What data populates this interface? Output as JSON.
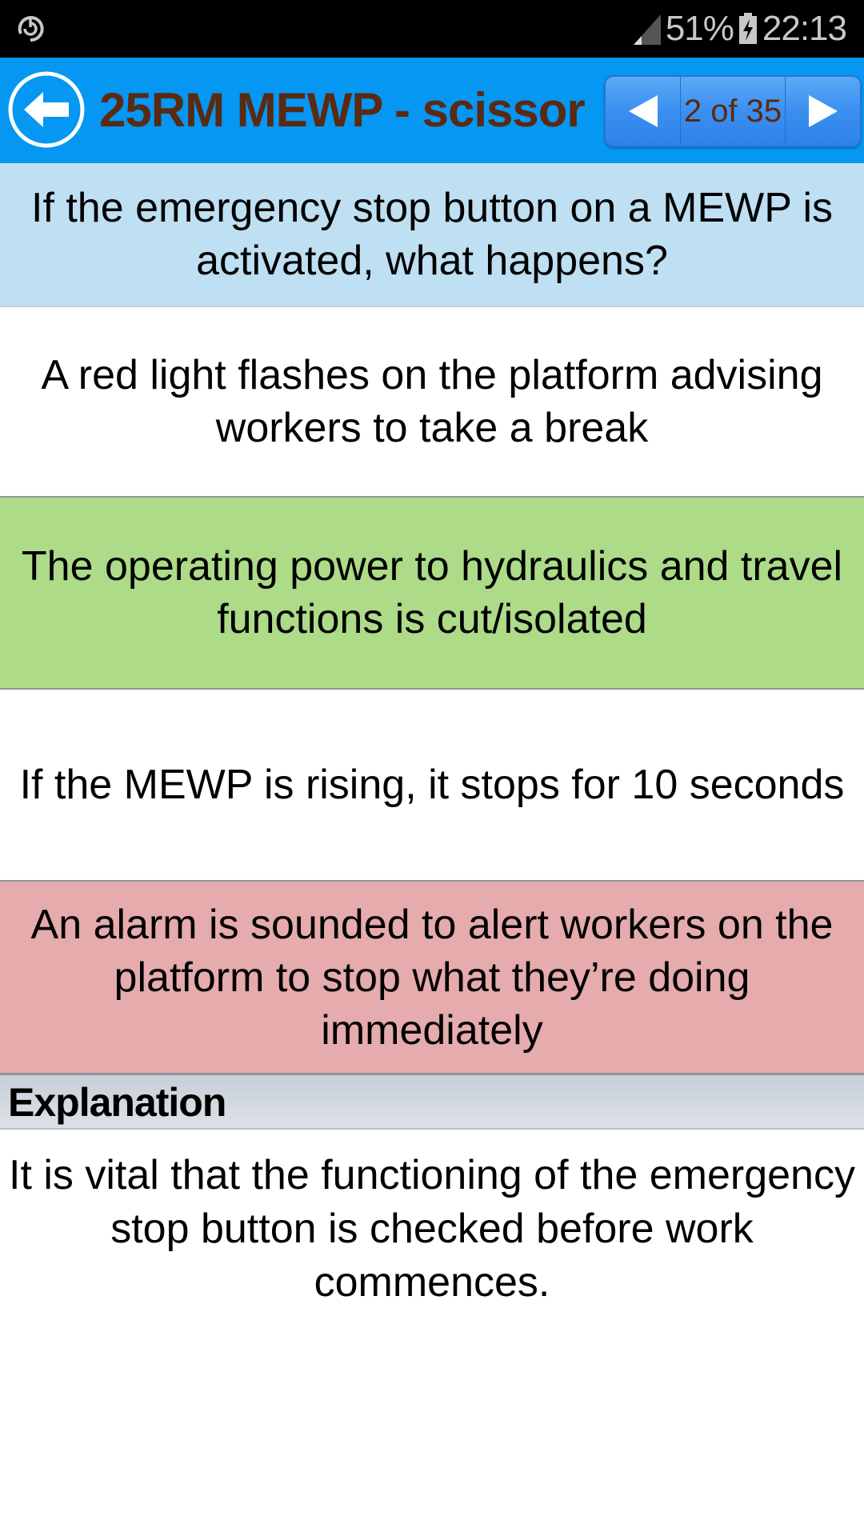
{
  "status_bar": {
    "left_icon": "sync-icon",
    "battery_percent": "51%",
    "time": "22:13",
    "icons": [
      "signal-icon",
      "battery-charging-icon"
    ]
  },
  "header": {
    "back_icon": "back-arrow-circle-icon",
    "title": "25RM MEWP - scissor",
    "pager": {
      "prev_icon": "triangle-left-icon",
      "count": "2 of 35",
      "next_icon": "triangle-right-icon"
    },
    "colors": {
      "bar": "#0597f2",
      "title": "#5a2a12"
    }
  },
  "question": {
    "text": "If the emergency stop button on a MEWP is activated, what happens?"
  },
  "answers": [
    {
      "text": "A red light flashes on the platform advising workers to take a break",
      "state": "neutral",
      "color": "#ffffff"
    },
    {
      "text": "The operating power to hydraulics and travel functions is cut/isolated",
      "state": "correct",
      "color": "#addb88"
    },
    {
      "text": "If the MEWP is rising, it stops for 10 seconds",
      "state": "neutral",
      "color": "#ffffff"
    },
    {
      "text": "An alarm is sounded to alert workers on the platform to stop what they’re doing immediately",
      "state": "incorrect",
      "color": "#e5abad"
    }
  ],
  "explanation": {
    "heading": "Explanation",
    "text": "It is vital that the functioning of the emergency stop button is checked before work commences."
  }
}
